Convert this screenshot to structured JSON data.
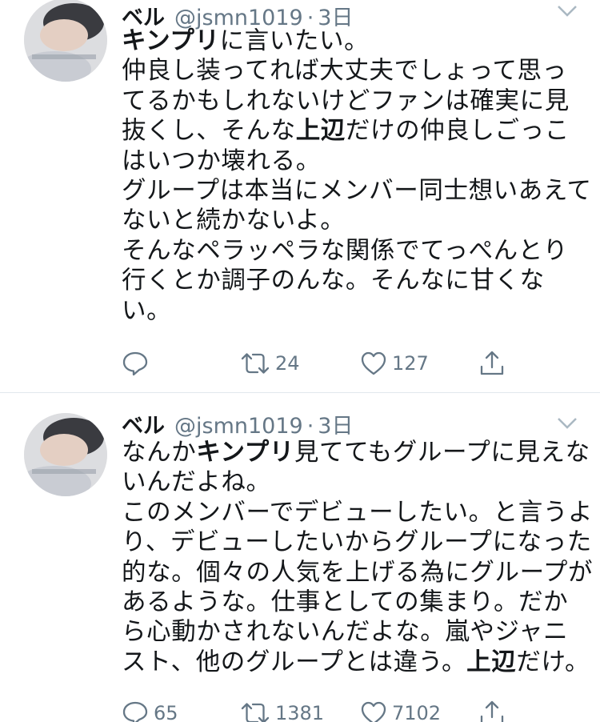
{
  "tweets": [
    {
      "name": "ベル",
      "handle": "@jsmn1019",
      "dot": "·",
      "time": "3日",
      "lines": [
        [
          {
            "t": "キンプリ",
            "b": true
          },
          {
            "t": "に言いたい。"
          }
        ],
        [
          {
            "t": "仲良し装ってれば大丈夫でしょって思っ"
          }
        ],
        [
          {
            "t": "てるかもしれないけどファンは確実に見"
          }
        ],
        [
          {
            "t": "抜くし、そんな"
          },
          {
            "t": "上辺",
            "b": true
          },
          {
            "t": "だけの仲良しごっこ"
          }
        ],
        [
          {
            "t": "はいつか壊れる。"
          }
        ],
        [
          {
            "t": "グループは本当にメンバー同士想いあえて"
          }
        ],
        [
          {
            "t": "ないと続かないよ。"
          }
        ],
        [
          {
            "t": "そんなペラッペラな関係でてっぺんとり"
          }
        ],
        [
          {
            "t": "行くとか調子のんな。そんなに甘くな"
          }
        ],
        [
          {
            "t": "い。"
          }
        ]
      ],
      "replies": "",
      "retweets": "24",
      "likes": "127"
    },
    {
      "name": "ベル",
      "handle": "@jsmn1019",
      "dot": "·",
      "time": "3日",
      "lines": [
        [
          {
            "t": "なんか"
          },
          {
            "t": "キンプリ",
            "b": true
          },
          {
            "t": "見ててもグループに見えな"
          }
        ],
        [
          {
            "t": "いんだよね。"
          }
        ],
        [
          {
            "t": "このメンバーでデビューしたい。と言うよ"
          }
        ],
        [
          {
            "t": "り、デビューしたいからグループになった"
          }
        ],
        [
          {
            "t": "的な。個々の人気を上げる為にグループが"
          }
        ],
        [
          {
            "t": "あるような。仕事としての集まり。だか"
          }
        ],
        [
          {
            "t": "ら心動かされないんだよな。嵐やジャニ"
          }
        ],
        [
          {
            "t": "スト、他のグループとは違う。"
          },
          {
            "t": "上辺",
            "b": true
          },
          {
            "t": "だけ。"
          }
        ]
      ],
      "replies": "65",
      "retweets": "1381",
      "likes": "7102"
    }
  ],
  "colors": {
    "text": "#14171a",
    "secondary": "#657786",
    "divider": "#e1e8ed"
  },
  "icons": [
    "reply-icon",
    "retweet-icon",
    "like-icon",
    "share-icon",
    "chevron-down-icon"
  ]
}
